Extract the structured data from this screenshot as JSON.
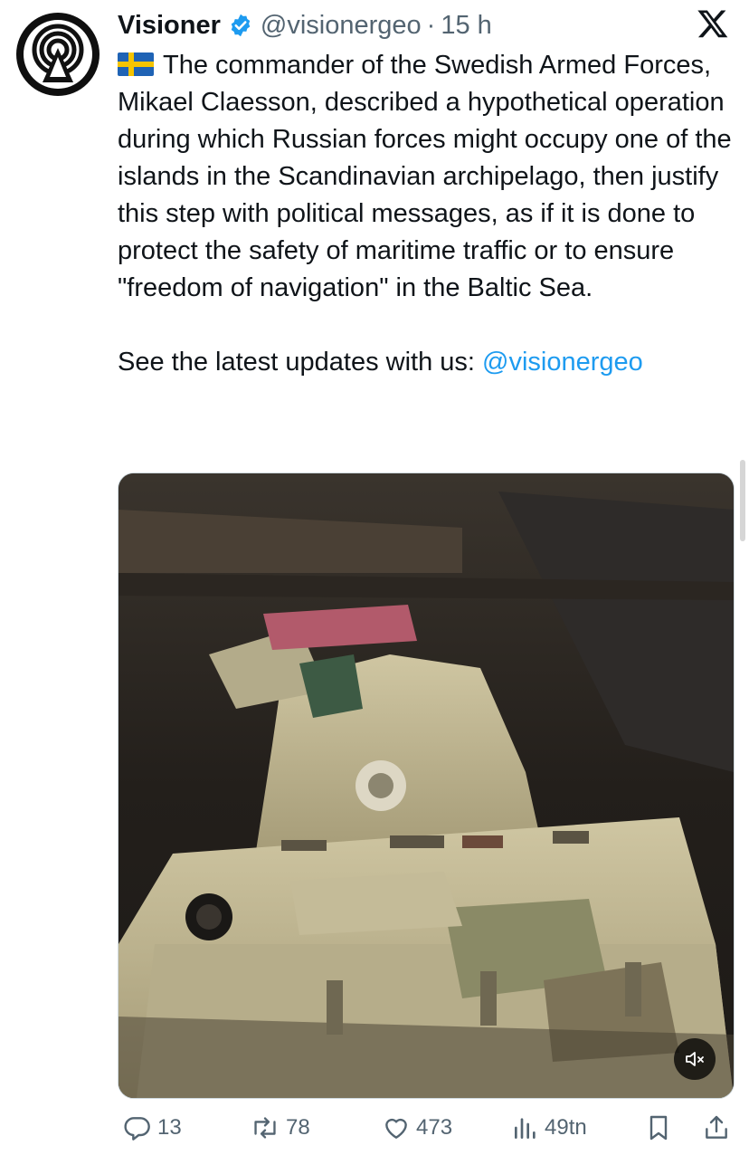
{
  "tweet": {
    "display_name": "Visioner",
    "handle": "@visionergeo",
    "separator": "·",
    "time": "15 h",
    "text_main": "The commander of the Swedish Armed Forces, Mikael Claesson, described a hypothetical operation during which Russian forces might occupy one of the islands in the Scandinavian archipelago, then justify this step with political messages, as if it is done to protect the safety of maritime traffic or to ensure \"freedom of navigation\" in the Baltic Sea.",
    "text_cta": "See the latest updates with us: ",
    "mention": "@visionergeo",
    "flag_icon": "sweden-flag-icon"
  },
  "metrics": {
    "replies": "13",
    "reposts": "78",
    "likes": "473",
    "views": "49tn"
  },
  "colors": {
    "accent": "#1d9bf0",
    "text": "#0f1419",
    "secondary": "#536471",
    "verified": "#1d9bf0"
  },
  "icons": {
    "logo": "x-logo-icon",
    "verified": "verified-badge-icon",
    "reply": "reply-icon",
    "repost": "repost-icon",
    "like": "heart-icon",
    "views": "views-icon",
    "bookmark": "bookmark-icon",
    "share": "share-icon",
    "mute": "mute-icon"
  }
}
